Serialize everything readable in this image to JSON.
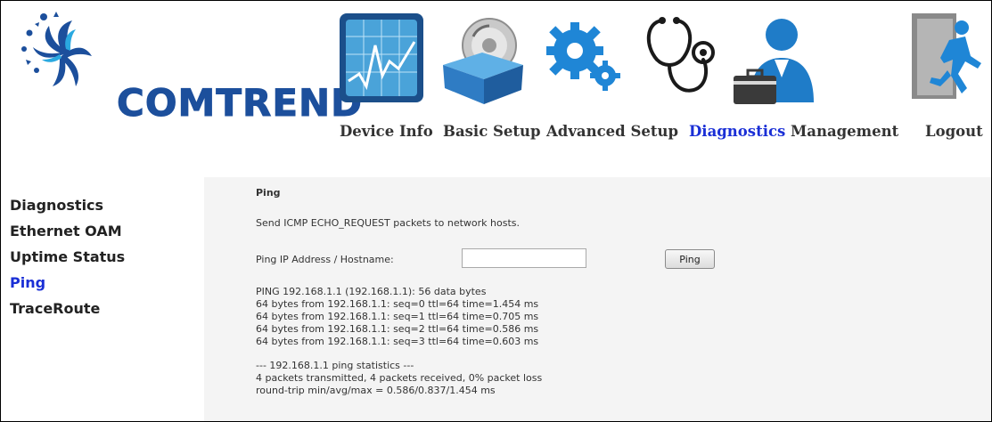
{
  "brand": {
    "name": "COMTREND",
    "colors": {
      "brand_blue": "#1c4f9c",
      "active_link": "#1a2fd6"
    }
  },
  "nav": {
    "items": [
      {
        "label": "Device Info",
        "icon": "device-info-icon",
        "active": false
      },
      {
        "label": "Basic Setup",
        "icon": "basic-setup-icon",
        "active": false
      },
      {
        "label": "Advanced Setup",
        "icon": "advanced-setup-icon",
        "active": false
      },
      {
        "label": "Diagnostics",
        "icon": "diagnostics-icon",
        "active": true
      },
      {
        "label": "Management",
        "icon": "management-icon",
        "active": false
      },
      {
        "label": "Logout",
        "icon": "logout-icon",
        "active": false
      }
    ]
  },
  "sidebar": {
    "items": [
      {
        "label": "Diagnostics",
        "active": false
      },
      {
        "label": "Ethernet OAM",
        "active": false
      },
      {
        "label": "Uptime Status",
        "active": false
      },
      {
        "label": "Ping",
        "active": true
      },
      {
        "label": "TraceRoute",
        "active": false
      }
    ]
  },
  "main": {
    "title": "Ping",
    "description": "Send ICMP ECHO_REQUEST packets to network hosts.",
    "field_label": "Ping IP Address / Hostname:",
    "field_value": "",
    "field_placeholder": "",
    "button_label": "Ping",
    "output": {
      "header": "PING 192.168.1.1 (192.168.1.1): 56 data bytes",
      "replies": [
        "64 bytes from 192.168.1.1: seq=0 ttl=64 time=1.454 ms",
        "64 bytes from 192.168.1.1: seq=1 ttl=64 time=0.705 ms",
        "64 bytes from 192.168.1.1: seq=2 ttl=64 time=0.586 ms",
        "64 bytes from 192.168.1.1: seq=3 ttl=64 time=0.603 ms"
      ],
      "stats_header": "--- 192.168.1.1 ping statistics ---",
      "stats_summary": "4 packets transmitted, 4 packets received, 0% packet loss",
      "round_trip": "round-trip min/avg/max = 0.586/0.837/1.454 ms"
    }
  }
}
